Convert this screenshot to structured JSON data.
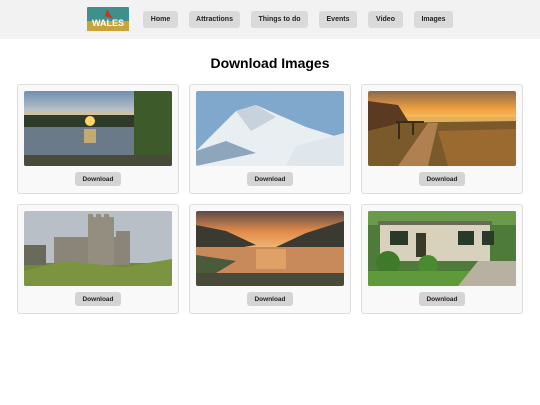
{
  "logo": {
    "text": "WALES"
  },
  "nav": [
    {
      "label": "Home"
    },
    {
      "label": "Attractions"
    },
    {
      "label": "Things to do"
    },
    {
      "label": "Events"
    },
    {
      "label": "Video"
    },
    {
      "label": "Images"
    }
  ],
  "page": {
    "title": "Download Images"
  },
  "cards": [
    {
      "image": "lake-sunset-photo",
      "button": "Download"
    },
    {
      "image": "snowy-mountain-photo",
      "button": "Download"
    },
    {
      "image": "coastal-path-sunset-photo",
      "button": "Download"
    },
    {
      "image": "castle-photo",
      "button": "Download"
    },
    {
      "image": "valley-lake-sunset-photo",
      "button": "Download"
    },
    {
      "image": "cottage-photo",
      "button": "Download"
    }
  ]
}
